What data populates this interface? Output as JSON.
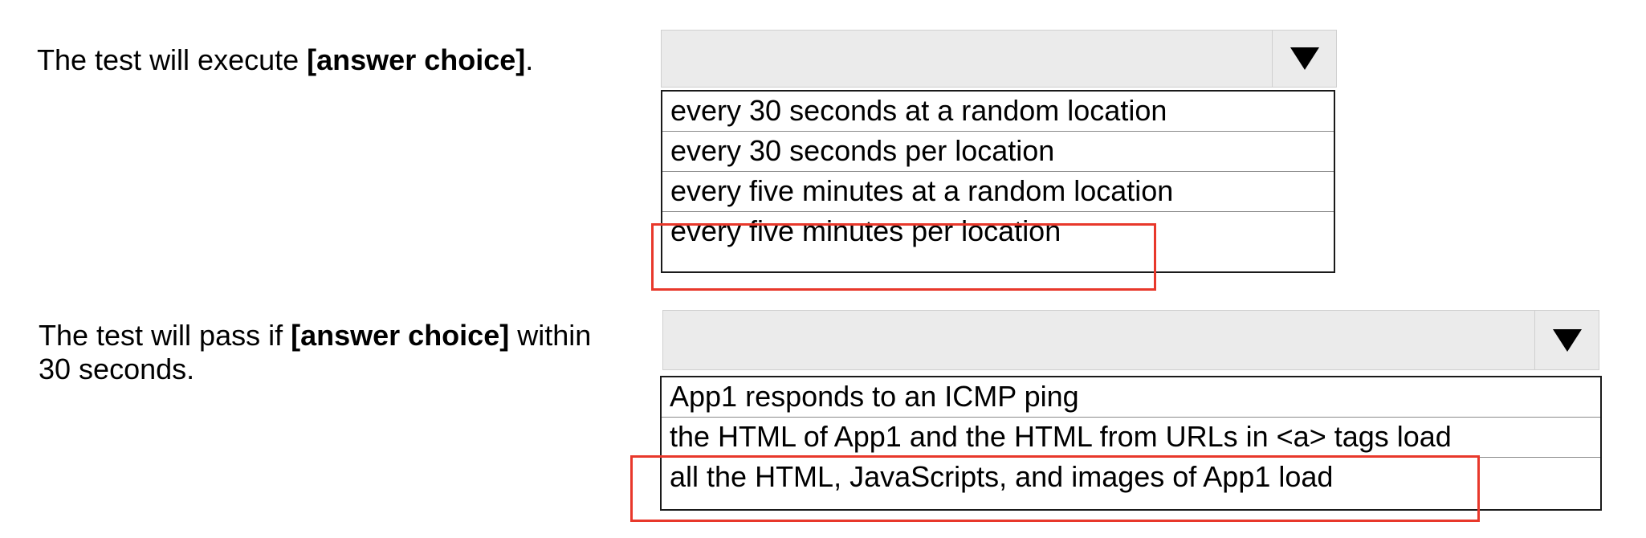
{
  "question1": {
    "prefix": "The test will execute ",
    "bold": "[answer choice]",
    "suffix": ".",
    "options": [
      "every 30 seconds at a random location",
      "every 30 seconds per location",
      "every five minutes at a random location",
      "every five minutes per location"
    ],
    "highlighted_option": "every five minutes per location"
  },
  "question2": {
    "prefix": "The test will pass if ",
    "bold": "[answer choice]",
    "suffix": " within 30 seconds.",
    "options": [
      "App1 responds to an ICMP ping",
      "the HTML of App1 and the HTML from URLs in <a> tags load",
      "all the HTML, JavaScripts, and images of App1 load"
    ],
    "highlighted_option": "all the HTML, JavaScripts, and images of App1 load"
  },
  "colors": {
    "highlight_border": "#e8382b",
    "dropdown_background": "#ebebeb",
    "list_border": "#1a1a1a"
  },
  "icons": {
    "dropdown_arrow": "triangle-down-icon"
  }
}
